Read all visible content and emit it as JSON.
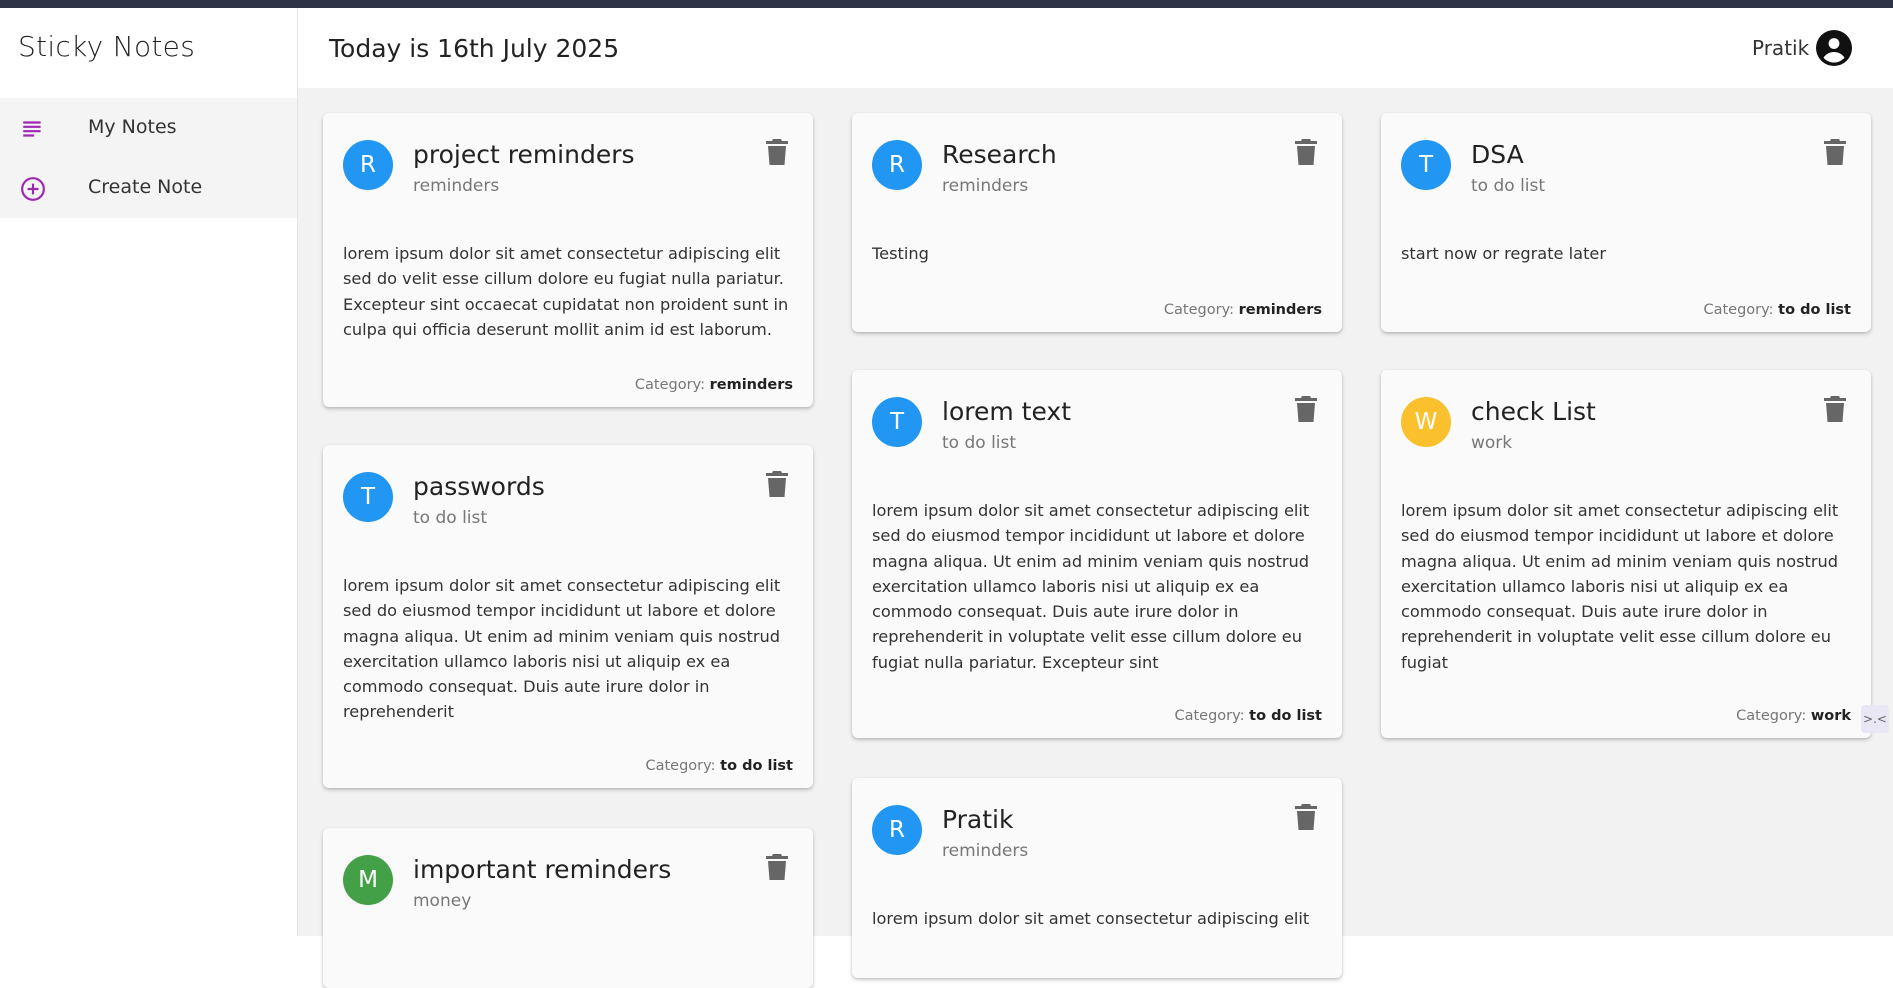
{
  "app": {
    "title": "Sticky Notes"
  },
  "sidebar": {
    "items": [
      {
        "label": "My Notes",
        "icon": "notes-lines-icon"
      },
      {
        "label": "Create Note",
        "icon": "add-circle-icon"
      }
    ]
  },
  "header": {
    "date_text": "Today is 16th July 2025",
    "user_name": "Pratik"
  },
  "colors": {
    "accent": "#9c27b0",
    "blue": "#2196f3",
    "yellow": "#fbc02d",
    "green": "#43a047",
    "topbar": "#2e3445"
  },
  "notes": [
    {
      "initial": "R",
      "title": "project reminders",
      "category": "reminders",
      "body": "lorem ipsum dolor sit amet consectetur adipiscing elit sed do velit esse cillum dolore eu fugiat nulla pariatur. Excepteur sint occaecat cupidatat non proident sunt in culpa qui officia deserunt mollit anim id est laborum.",
      "footer_label": "Category:",
      "footer_value": "reminders"
    },
    {
      "initial": "T",
      "title": "passwords",
      "category": "to do list",
      "body": "lorem ipsum dolor sit amet consectetur adipiscing elit sed do eiusmod tempor incididunt ut labore et dolore magna aliqua. Ut enim ad minim veniam quis nostrud exercitation ullamco laboris nisi ut aliquip ex ea commodo consequat. Duis aute irure dolor in reprehenderit",
      "footer_label": "Category:",
      "footer_value": "to do list"
    },
    {
      "initial": "M",
      "title": "important reminders",
      "category": "money",
      "body": "",
      "footer_label": "",
      "footer_value": ""
    },
    {
      "initial": "R",
      "title": "Research",
      "category": "reminders",
      "body": "Testing",
      "footer_label": "Category:",
      "footer_value": "reminders"
    },
    {
      "initial": "T",
      "title": "lorem text",
      "category": "to do list",
      "body": "lorem ipsum dolor sit amet consectetur adipiscing elit sed do eiusmod tempor incididunt ut labore et dolore magna aliqua. Ut enim ad minim veniam quis nostrud exercitation ullamco laboris nisi ut aliquip ex ea commodo consequat. Duis aute irure dolor in reprehenderit in voluptate velit esse cillum dolore eu fugiat nulla pariatur. Excepteur sint",
      "footer_label": "Category:",
      "footer_value": "to do list"
    },
    {
      "initial": "R",
      "title": "Pratik",
      "category": "reminders",
      "body": "lorem ipsum dolor sit amet consectetur adipiscing elit",
      "footer_label": "",
      "footer_value": ""
    },
    {
      "initial": "T",
      "title": "DSA",
      "category": "to do list",
      "body": "start now or regrate later",
      "footer_label": "Category:",
      "footer_value": "to do list"
    },
    {
      "initial": "W",
      "title": "check List",
      "category": "work",
      "body": "lorem ipsum dolor sit amet consectetur adipiscing elit sed do eiusmod tempor incididunt ut labore et dolore magna aliqua. Ut enim ad minim veniam quis nostrud exercitation ullamco laboris nisi ut aliquip ex ea commodo consequat. Duis aute irure dolor in reprehenderit in voluptate velit esse cillum dolore eu fugiat",
      "footer_label": "Category:",
      "footer_value": "work"
    }
  ],
  "handle_text": ">.<"
}
